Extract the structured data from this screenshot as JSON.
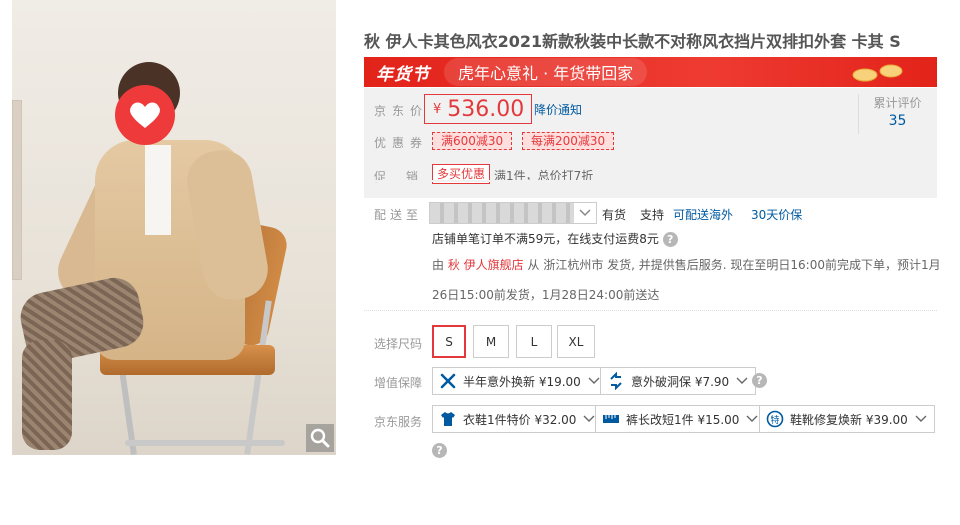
{
  "product": {
    "title": "秋 伊人卡其色风衣2021新款秋装中长款不对称风衣挡片双排扣外套 卡其 S"
  },
  "banner": {
    "logo_text": "年货节",
    "slogan": "虎年心意礼 · 年货带回家"
  },
  "price": {
    "label": "京东价",
    "currency": "¥",
    "value": "536.00",
    "notify_link": "降价通知"
  },
  "reviews": {
    "label": "累计评价",
    "count": "35"
  },
  "coupons": {
    "label": "优惠券",
    "items": [
      "满600减30",
      "每满200减30"
    ]
  },
  "promotion": {
    "label": "促销",
    "tag": "多买优惠",
    "text": "满1件，总价打7折"
  },
  "delivery": {
    "label": "配送至",
    "stock": "有货",
    "support": "支持",
    "overseas_link": "可配送海外",
    "price_protect_link": "30天价保",
    "shipping_fee": "店铺单笔订单不满59元，在线支付运费8元",
    "ship_prefix": "由",
    "shop_name": "秋 伊人旗舰店",
    "ship_detail_1": "从 浙江杭州市 发货, 并提供售后服务. 现在至明日16:00前完成下单，预计1月",
    "ship_detail_2": "26日15:00前发货，1月28日24:00前送达"
  },
  "sizes": {
    "label": "选择尺码",
    "options": [
      "S",
      "M",
      "L",
      "XL"
    ],
    "selected": "S"
  },
  "value_added": {
    "label": "增值保障",
    "items": [
      "半年意外换新 ¥19.00",
      "意外破洞保 ¥7.90"
    ]
  },
  "jd_services": {
    "label": "京东服务",
    "items": [
      "衣鞋1件特价 ¥32.00",
      "裤长改短1件 ¥15.00",
      "鞋靴修复焕新 ¥39.00"
    ]
  },
  "colors": {
    "accent": "#e4393c",
    "link": "#005aa0",
    "banner": "#e2231a"
  }
}
